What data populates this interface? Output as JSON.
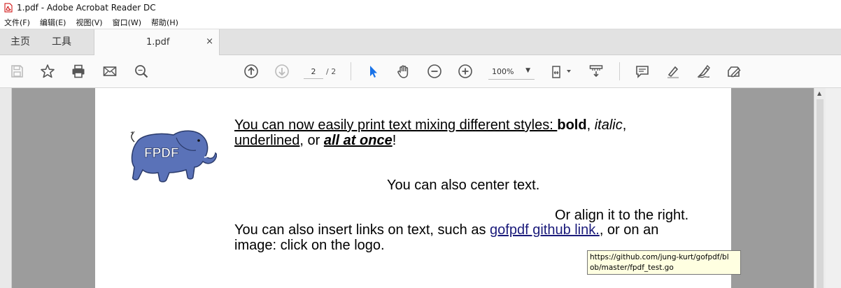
{
  "window": {
    "title": "1.pdf - Adobe Acrobat Reader DC"
  },
  "menu": [
    {
      "label": "文件(F)"
    },
    {
      "label": "编辑(E)"
    },
    {
      "label": "视图(V)"
    },
    {
      "label": "窗口(W)"
    },
    {
      "label": "帮助(H)"
    }
  ],
  "tabs": {
    "home": "主页",
    "tools": "工具",
    "document": "1.pdf",
    "close": "×"
  },
  "toolbar": {
    "page_current": "2",
    "page_total": "/ 2",
    "zoom": "100%",
    "zoom_caret": "▼",
    "icons": [
      "save-icon",
      "star-icon",
      "print-icon",
      "email-icon",
      "search-icon",
      "prev-page-icon",
      "next-page-icon",
      "select-cursor-icon",
      "hand-tool-icon",
      "zoom-out-icon",
      "zoom-in-icon",
      "fit-page-icon",
      "scroll-mode-icon",
      "comment-icon",
      "highlight-icon",
      "sign-icon",
      "edit-icon"
    ]
  },
  "document": {
    "logo_text": "FPDF",
    "line1": {
      "a": "You can now easily print text mixing different styles: ",
      "bold": "bold",
      "comma1": ", ",
      "italic": "italic",
      "comma2": ","
    },
    "line2": {
      "underlined": "underlined",
      "or": ", or ",
      "all": "all at once",
      "end": "!"
    },
    "center": "You can also center text.",
    "right": "Or align it to the right.",
    "links": {
      "a": "You can also insert links on text, such as ",
      "link": "gofpdf github link.",
      "b": ", or on an"
    },
    "image_line": "image: click on the logo."
  },
  "tooltip": {
    "line1": "https://github.com/jung-kurt/gofpdf/bl",
    "line2": "ob/master/fpdf_test.go"
  },
  "colors": {
    "link": "#1a1a7a",
    "accent_cursor": "#1a73e8",
    "tooltip_bg": "#ffffe1",
    "doc_bg": "#9c9c9c"
  }
}
